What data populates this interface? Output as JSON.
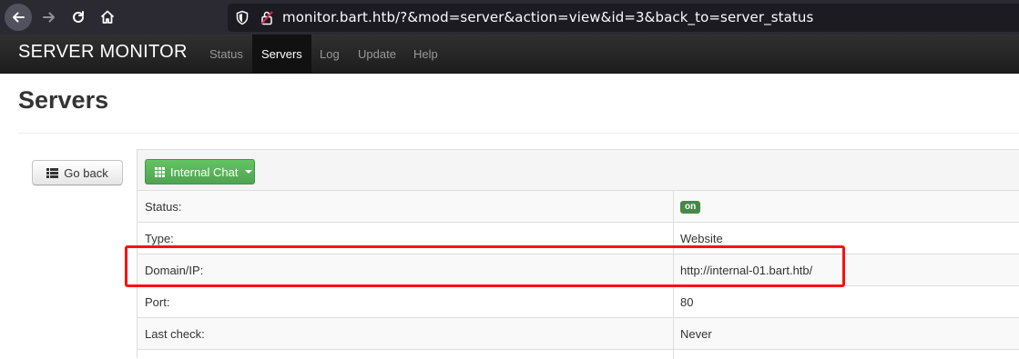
{
  "browser": {
    "url": "monitor.bart.htb/?&mod=server&action=view&id=3&back_to=server_status"
  },
  "navbar": {
    "brand": "SERVER MONITOR",
    "items": [
      {
        "label": "Status",
        "active": false
      },
      {
        "label": "Servers",
        "active": true
      },
      {
        "label": "Log",
        "active": false
      },
      {
        "label": "Update",
        "active": false
      },
      {
        "label": "Help",
        "active": false
      }
    ]
  },
  "page": {
    "title": "Servers",
    "go_back_label": "Go back",
    "server_button_label": "Internal Chat"
  },
  "details": [
    {
      "label": "Status:",
      "value": "on",
      "badge": true
    },
    {
      "label": "Type:",
      "value": "Website"
    },
    {
      "label": "Domain/IP:",
      "value": "http://internal-01.bart.htb/"
    },
    {
      "label": "Port:",
      "value": "80"
    },
    {
      "label": "Last check:",
      "value": "Never"
    }
  ],
  "colors": {
    "status_on": "#468847",
    "highlight": "#ff1010",
    "primary_button": "#51a351"
  }
}
